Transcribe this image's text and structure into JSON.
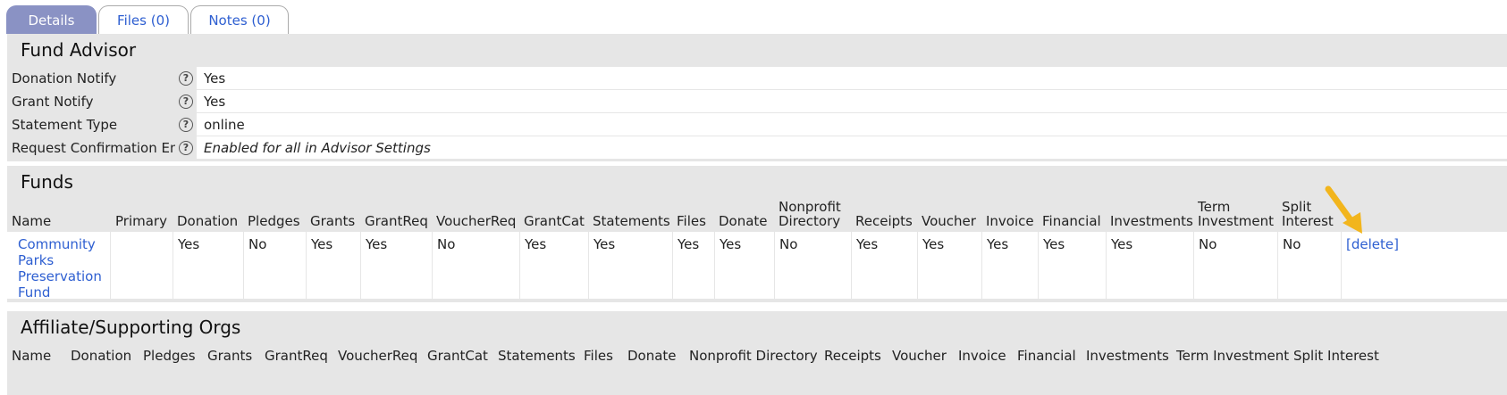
{
  "tabs": [
    {
      "label": "Details",
      "active": true
    },
    {
      "label": "Files (0)",
      "active": false
    },
    {
      "label": "Notes (0)",
      "active": false
    }
  ],
  "fund_advisor": {
    "title": "Fund Advisor",
    "rows": [
      {
        "label": "Donation Notify",
        "value": "Yes"
      },
      {
        "label": "Grant Notify",
        "value": "Yes"
      },
      {
        "label": "Statement Type",
        "value": "online"
      },
      {
        "label": "Request Confirmation Email",
        "value": "Enabled for all in Advisor Settings"
      }
    ]
  },
  "funds": {
    "title": "Funds",
    "headers": [
      "Name",
      "Primary",
      "Donation",
      "Pledges",
      "Grants",
      "GrantReq",
      "VoucherReq",
      "GrantCat",
      "Statements",
      "Files",
      "Donate",
      "Nonprofit Directory",
      "Receipts",
      "Voucher",
      "Invoice",
      "Financial",
      "Investments",
      "Term Investment",
      "Split Interest"
    ],
    "rows": [
      {
        "name": "Community Parks Preservation Fund",
        "primary": "",
        "cells": [
          "Yes",
          "No",
          "Yes",
          "Yes",
          "No",
          "Yes",
          "Yes",
          "Yes",
          "Yes",
          "No",
          "Yes",
          "Yes",
          "Yes",
          "Yes",
          "Yes",
          "No",
          "No"
        ],
        "action": "[delete]"
      }
    ]
  },
  "affiliates": {
    "title": "Affiliate/Supporting Orgs",
    "headers": [
      "Name",
      "Donation",
      "Pledges",
      "Grants",
      "GrantReq",
      "VoucherReq",
      "GrantCat",
      "Statements",
      "Files",
      "Donate",
      "Nonprofit Directory",
      "Receipts",
      "Voucher",
      "Invoice",
      "Financial",
      "Investments",
      "Term Investment",
      "Split Interest"
    ]
  },
  "colors": {
    "active_tab": "#8a92c4",
    "link": "#2e5fd1",
    "section_bg": "#e6e6e6",
    "arrow": "#f2b51d"
  }
}
